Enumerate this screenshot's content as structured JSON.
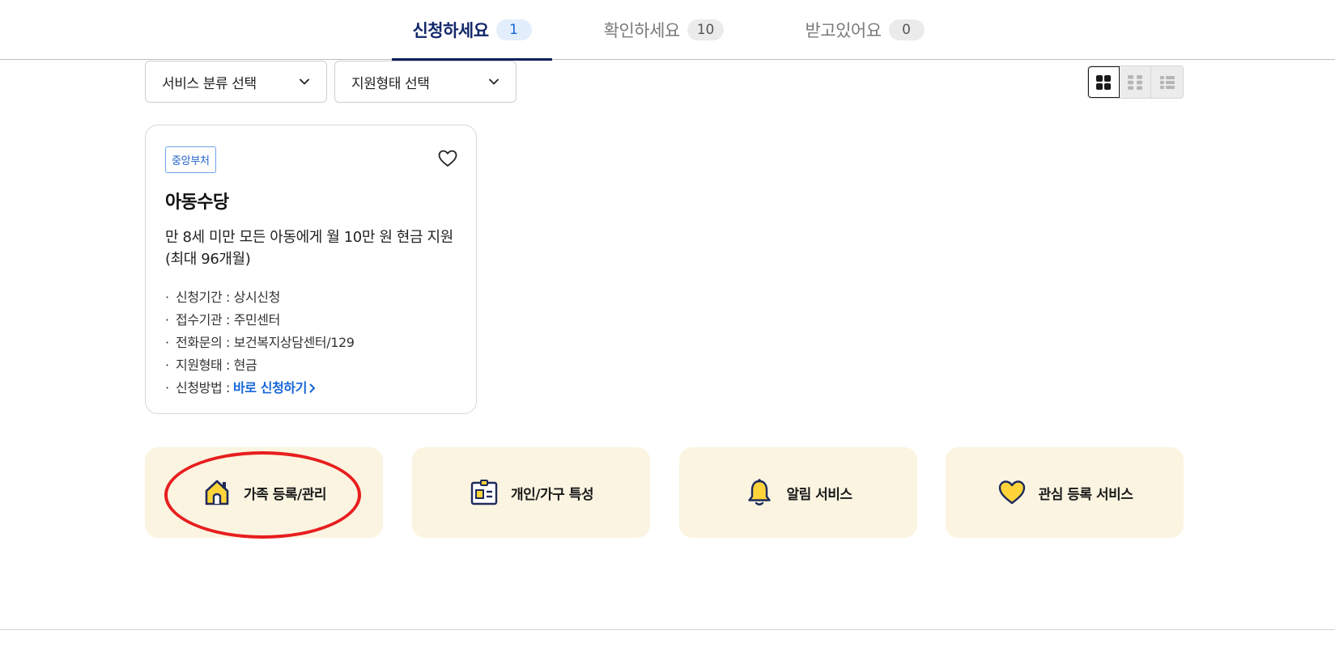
{
  "tabs": [
    {
      "label": "신청하세요",
      "count": "1"
    },
    {
      "label": "확인하세요",
      "count": "10"
    },
    {
      "label": "받고있어요",
      "count": "0"
    }
  ],
  "filters": {
    "category_label": "서비스 분류 선택",
    "support_label": "지원형태 선택"
  },
  "card": {
    "badge": "중앙부처",
    "title": "아동수당",
    "description": "만 8세 미만 모든 아동에게 월 10만 원 현금 지원 (최대 96개월)",
    "info": [
      {
        "key": "신청기간",
        "value": "상시신청"
      },
      {
        "key": "접수기관",
        "value": "주민센터"
      },
      {
        "key": "전화문의",
        "value": "보건복지상담센터/129"
      },
      {
        "key": "지원형태",
        "value": "현금"
      },
      {
        "key": "신청방법",
        "value": "바로 신청하기"
      }
    ]
  },
  "tiles": [
    {
      "label": "가족 등록/관리",
      "icon": "house-icon"
    },
    {
      "label": "개인/가구 특성",
      "icon": "id-card-icon"
    },
    {
      "label": "알림 서비스",
      "icon": "bell-icon"
    },
    {
      "label": "관심 등록 서비스",
      "icon": "heart-icon"
    }
  ],
  "colors": {
    "accent_navy": "#13286b",
    "link_blue": "#1565d8",
    "tile_bg": "#faf4e1",
    "icon_yellow": "#ffd43b",
    "icon_navy": "#1e2a5a",
    "highlight_red": "#e81e1e"
  }
}
